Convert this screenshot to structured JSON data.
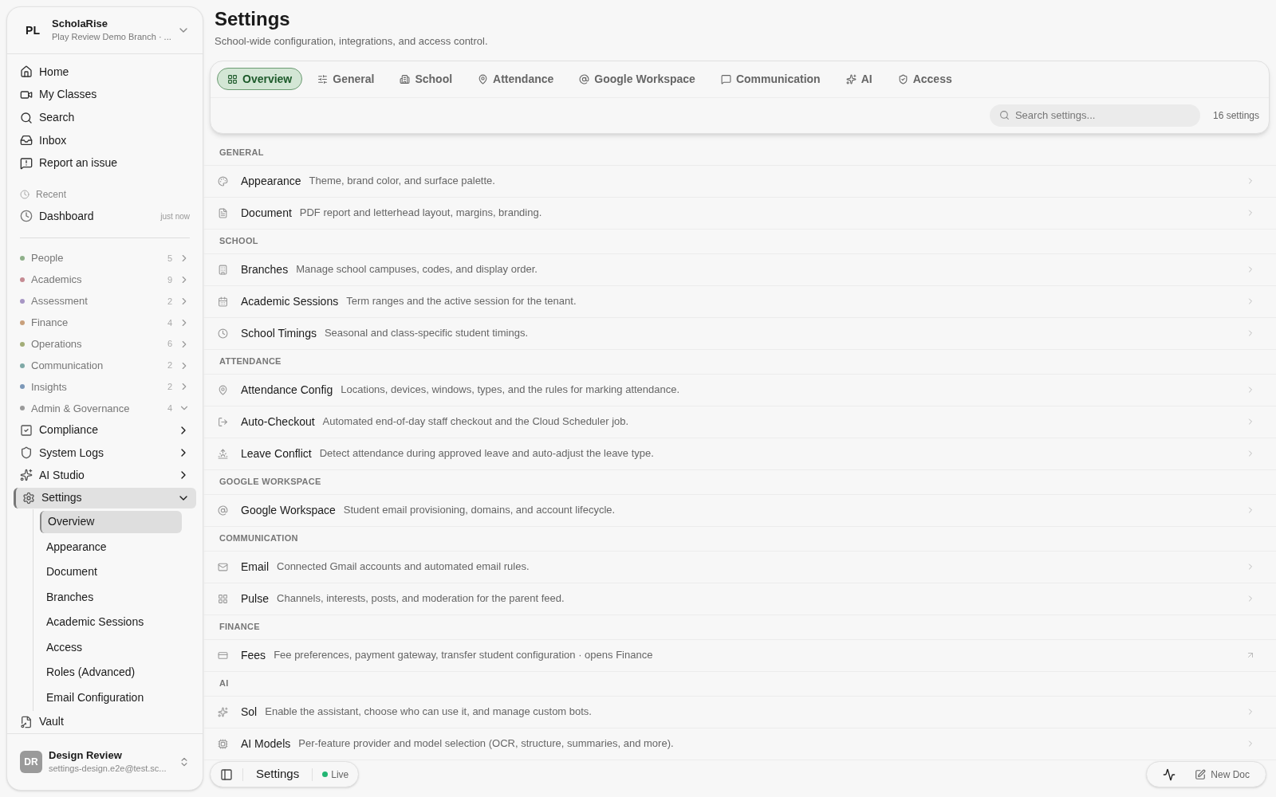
{
  "workspace": {
    "initials": "PL",
    "name": "ScholaRise",
    "branch": "Play Review Demo Branch · ..."
  },
  "nav": [
    {
      "label": "Home"
    },
    {
      "label": "My Classes"
    },
    {
      "label": "Search"
    },
    {
      "label": "Inbox"
    },
    {
      "label": "Report an issue"
    }
  ],
  "recent": {
    "heading": "Recent",
    "items": [
      {
        "label": "Dashboard",
        "time": "just now"
      }
    ]
  },
  "groups": [
    {
      "label": "People",
      "count": "5",
      "color": "#8fb08a",
      "expanded": false
    },
    {
      "label": "Academics",
      "count": "9",
      "color": "#c58b93",
      "expanded": false
    },
    {
      "label": "Assessment",
      "count": "2",
      "color": "#a796c4",
      "expanded": false
    },
    {
      "label": "Finance",
      "count": "4",
      "color": "#c8a07c",
      "expanded": false
    },
    {
      "label": "Operations",
      "count": "6",
      "color": "#a3ad78",
      "expanded": false
    },
    {
      "label": "Communication",
      "count": "2",
      "color": "#7fa9a6",
      "expanded": false
    },
    {
      "label": "Insights",
      "count": "2",
      "color": "#7c98b8",
      "expanded": false
    },
    {
      "label": "Admin & Governance",
      "count": "4",
      "color": "#9a9a9a",
      "expanded": true
    }
  ],
  "admin_items": [
    {
      "label": "Compliance",
      "expanded": false,
      "selected": false
    },
    {
      "label": "System Logs",
      "expanded": false,
      "selected": false
    },
    {
      "label": "AI Studio",
      "expanded": false,
      "selected": false
    },
    {
      "label": "Settings",
      "expanded": true,
      "selected": true,
      "children": [
        {
          "label": "Overview",
          "selected": true
        },
        {
          "label": "Appearance",
          "selected": false
        },
        {
          "label": "Document",
          "selected": false
        },
        {
          "label": "Branches",
          "selected": false
        },
        {
          "label": "Academic Sessions",
          "selected": false
        },
        {
          "label": "Access",
          "selected": false
        },
        {
          "label": "Roles (Advanced)",
          "selected": false
        },
        {
          "label": "Email Configuration",
          "selected": false
        }
      ]
    },
    {
      "label": "Vault",
      "selected": false
    }
  ],
  "user": {
    "initials": "DR",
    "name": "Design Review",
    "email": "settings-design.e2e@test.sc..."
  },
  "page": {
    "title": "Settings",
    "subtitle": "School-wide configuration, integrations, and access control."
  },
  "tabs": [
    {
      "label": "Overview",
      "selected": true
    },
    {
      "label": "General",
      "selected": false
    },
    {
      "label": "School",
      "selected": false
    },
    {
      "label": "Attendance",
      "selected": false
    },
    {
      "label": "Google Workspace",
      "selected": false
    },
    {
      "label": "Communication",
      "selected": false
    },
    {
      "label": "AI",
      "selected": false
    },
    {
      "label": "Access",
      "selected": false
    }
  ],
  "search": {
    "placeholder": "Search settings...",
    "count": "16 settings"
  },
  "sections": [
    {
      "heading": "GENERAL",
      "rows": [
        {
          "title": "Appearance",
          "description": "Theme, brand color, and surface palette.",
          "kind": "internal"
        },
        {
          "title": "Document",
          "description": "PDF report and letterhead layout, margins, branding.",
          "kind": "internal"
        }
      ]
    },
    {
      "heading": "SCHOOL",
      "rows": [
        {
          "title": "Branches",
          "description": "Manage school campuses, codes, and display order.",
          "kind": "internal"
        },
        {
          "title": "Academic Sessions",
          "description": "Term ranges and the active session for the tenant.",
          "kind": "internal"
        },
        {
          "title": "School Timings",
          "description": "Seasonal and class-specific student timings.",
          "kind": "internal"
        }
      ]
    },
    {
      "heading": "ATTENDANCE",
      "rows": [
        {
          "title": "Attendance Config",
          "description": "Locations, devices, windows, types, and the rules for marking attendance.",
          "kind": "internal"
        },
        {
          "title": "Auto-Checkout",
          "description": "Automated end-of-day staff checkout and the Cloud Scheduler job.",
          "kind": "internal"
        },
        {
          "title": "Leave Conflict",
          "description": "Detect attendance during approved leave and auto-adjust the leave type.",
          "kind": "internal"
        }
      ]
    },
    {
      "heading": "GOOGLE WORKSPACE",
      "rows": [
        {
          "title": "Google Workspace",
          "description": "Student email provisioning, domains, and account lifecycle.",
          "kind": "internal"
        }
      ]
    },
    {
      "heading": "COMMUNICATION",
      "rows": [
        {
          "title": "Email",
          "description": "Connected Gmail accounts and automated email rules.",
          "kind": "internal"
        },
        {
          "title": "Pulse",
          "description": "Channels, interests, posts, and moderation for the parent feed.",
          "kind": "internal"
        }
      ]
    },
    {
      "heading": "FINANCE",
      "rows": [
        {
          "title": "Fees",
          "description": "Fee preferences, payment gateway, transfer student configuration · opens Finance",
          "kind": "external"
        }
      ]
    },
    {
      "heading": "AI",
      "rows": [
        {
          "title": "Sol",
          "description": "Enable the assistant, choose who can use it, and manage custom bots.",
          "kind": "internal"
        },
        {
          "title": "AI Models",
          "description": "Per-feature provider and model selection (OCR, structure, summaries, and more).",
          "kind": "internal"
        }
      ]
    }
  ],
  "bottom_bar": {
    "title": "Settings",
    "status": "Live",
    "live": true,
    "new_doc": "New Doc"
  }
}
